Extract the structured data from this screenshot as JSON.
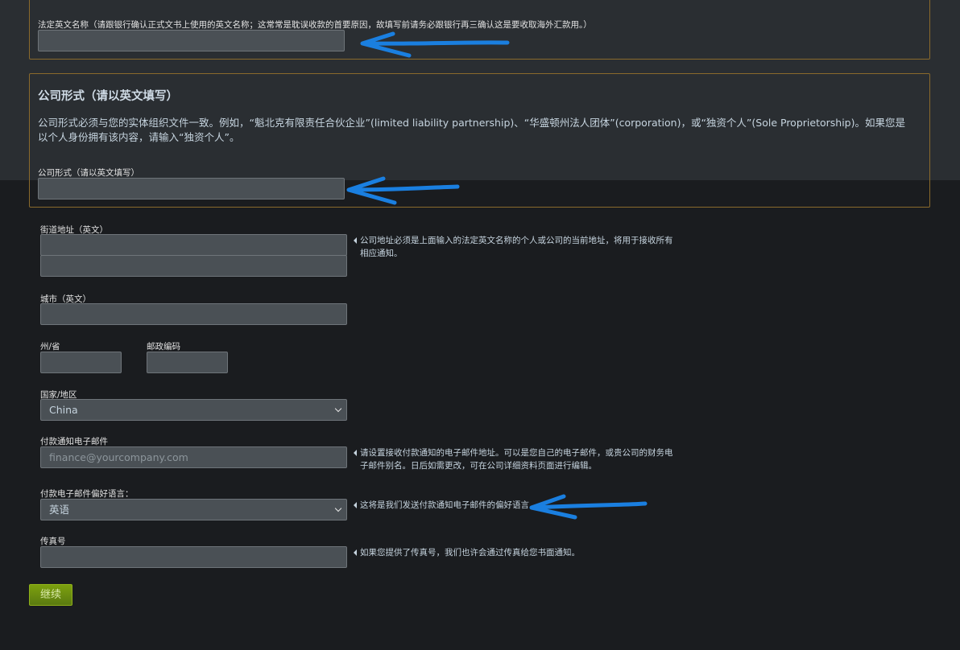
{
  "legal_name": {
    "label": "法定英文名称（请跟银行确认正式文书上使用的英文名称；这常常是耽误收款的首要原因，故填写前请务必跟银行再三确认这是要收取海外汇款用。）",
    "value": ""
  },
  "company_form_section": {
    "heading": "公司形式（请以英文填写）",
    "description": "公司形式必须与您的实体组织文件一致。例如，“魁北克有限责任合伙企业”(limited liability partnership)、“华盛顿州法人团体”(corporation)，或“独资个人”(Sole Proprietorship)。如果您是以个人身份拥有该内容，请输入“独资个人”。",
    "label": "公司形式（请以英文填写）",
    "value": ""
  },
  "street": {
    "label": "街道地址（英文）",
    "line1": "",
    "line2": "",
    "hint": "公司地址必须是上面输入的法定英文名称的个人或公司的当前地址，将用于接收所有相应通知。"
  },
  "city": {
    "label": "城市（英文）",
    "value": ""
  },
  "state": {
    "label": "州/省",
    "value": ""
  },
  "postal": {
    "label": "邮政编码",
    "value": ""
  },
  "country": {
    "label": "国家/地区",
    "selected": "China"
  },
  "payment_email": {
    "label": "付款通知电子邮件",
    "placeholder": "finance@yourcompany.com",
    "hint": "请设置接收付款通知的电子邮件地址。可以是您自己的电子邮件，或贵公司的财务电子邮件别名。日后如需更改，可在公司详细资料页面进行编辑。"
  },
  "email_language": {
    "label": "付款电子邮件偏好语言：",
    "selected": "英语",
    "hint": "这将是我们发送付款通知电子邮件的偏好语言"
  },
  "fax": {
    "label": "传真号",
    "value": "",
    "hint": "如果您提供了传真号，我们也许会通过传真给您书面通知。"
  },
  "continue_button": "继续",
  "annotation_color": "#1a7fe0"
}
